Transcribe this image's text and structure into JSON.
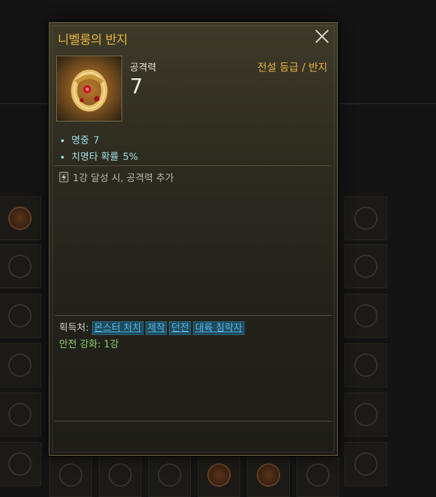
{
  "item": {
    "name": "니벨룽의 반지",
    "stat_label": "공격력",
    "stat_value": "7",
    "grade": "전설 등급 / 반지"
  },
  "bonuses": [
    {
      "label": "명중",
      "value": "7"
    },
    {
      "label": "치명타 확률",
      "value": "5%"
    }
  ],
  "enhancement_note": "1강 달성 시, 공격력 추가",
  "acquisition": {
    "label": "획득처:",
    "sources": [
      "몬스터 처치",
      "제작",
      "던전",
      "대륙 침략자"
    ]
  },
  "safe_enhancement": "안전 강화: 1강",
  "colors": {
    "title": "#e8b53b",
    "bonus": "#9fdfe6",
    "link": "#55b8e8",
    "safe": "#8fd36a"
  },
  "icons": {
    "close": "close-icon",
    "item": "ring-icon",
    "enhancement": "enhance-scroll-icon"
  }
}
